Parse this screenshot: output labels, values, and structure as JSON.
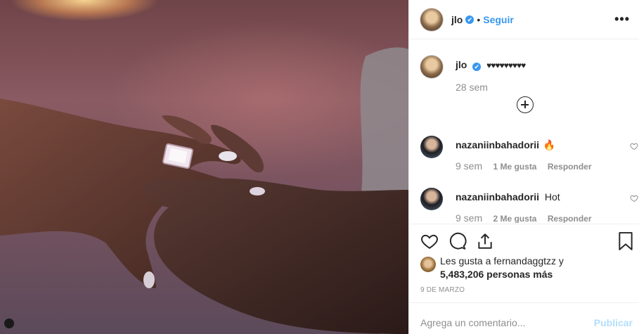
{
  "post": {
    "username": "jlo",
    "verified_mark": "✔",
    "separator": "•",
    "follow_label": "Seguir",
    "more_label": "•••"
  },
  "caption": {
    "username": "jlo",
    "text": "♥♥♥♥♥♥♥♥♥",
    "time": "28 sem"
  },
  "comments": [
    {
      "username": "nazaniinbahadorii",
      "text": "🔥",
      "time": "9 sem",
      "likes": "1 Me gusta",
      "reply": "Responder"
    },
    {
      "username": "nazaniinbahadorii",
      "text": "Hot",
      "time": "9 sem",
      "likes": "2 Me gusta",
      "reply": "Responder"
    }
  ],
  "likes": {
    "line1": "Les gusta a fernandaggtzz y",
    "line2": "5,483,206 personas más"
  },
  "date": "9 DE MARZO",
  "add_comment": {
    "placeholder": "Agrega un comentario...",
    "publish_label": "Publicar"
  },
  "icons": [
    "heart-icon",
    "comment-icon",
    "share-icon",
    "bookmark-icon",
    "more-options-icon",
    "load-more-icon",
    "instagram-icon"
  ],
  "colors": {
    "accent": "#3897f0",
    "text": "#262626",
    "muted": "#8e8e8e",
    "publish_disabled": "#b2dffc"
  }
}
